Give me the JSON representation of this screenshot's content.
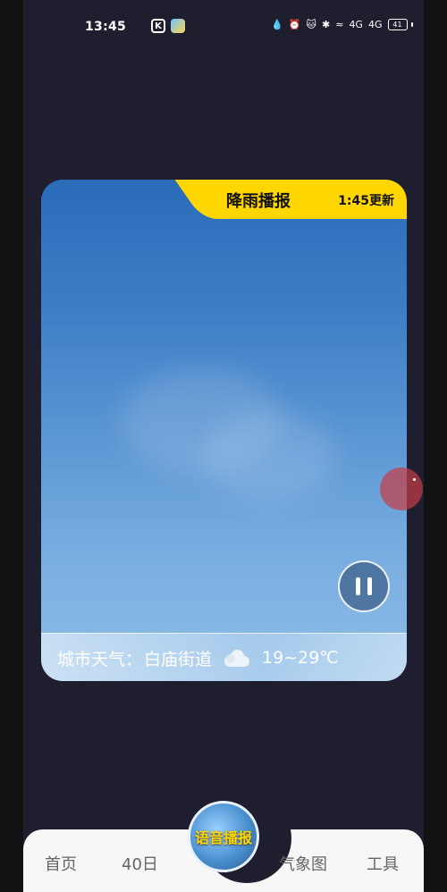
{
  "status_bar": {
    "time": "13:45",
    "app_icons": [
      "kugou-icon",
      "weather-app-icon"
    ],
    "right_icons": [
      "drop-icon",
      "alarm-icon",
      "cat-icon",
      "bluetooth-icon",
      "vibrate-icon"
    ],
    "signal1": "4G",
    "signal2": "4G",
    "battery": "41"
  },
  "card": {
    "tag_title": "降雨播报",
    "tag_time": "1:45更新",
    "city_label": "城市天气：",
    "street": "白庙街道",
    "weather_icon": "cloud-icon",
    "temperature": "19~29℃"
  },
  "bottom_nav": {
    "home": "首页",
    "forty_day": "40日",
    "voice": "语音播报",
    "weather_map": "气象图",
    "tools": "工具"
  },
  "colors": {
    "tag_yellow": "#ffd600",
    "sky_top": "#2a6cb8",
    "sky_bottom": "#8ebde8",
    "float_dot": "#c83c46"
  }
}
